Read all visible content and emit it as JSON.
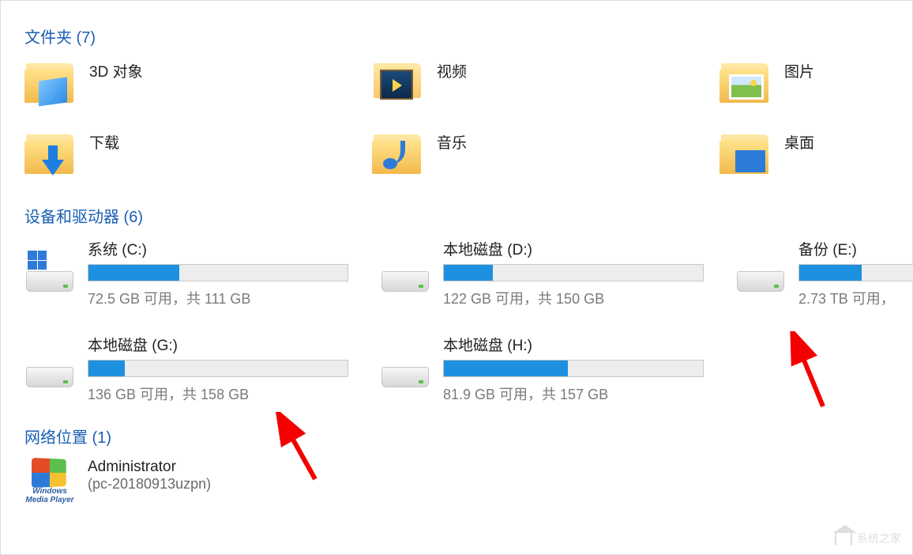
{
  "sections": {
    "folders_header": "文件夹 (7)",
    "drives_header": "设备和驱动器 (6)",
    "network_header": "网络位置 (1)"
  },
  "folders": [
    {
      "label": "3D 对象",
      "icon": "3d"
    },
    {
      "label": "视频",
      "icon": "video"
    },
    {
      "label": "图片",
      "icon": "pic"
    },
    {
      "label": "下载",
      "icon": "down"
    },
    {
      "label": "音乐",
      "icon": "music"
    },
    {
      "label": "桌面",
      "icon": "desk"
    }
  ],
  "drives": [
    {
      "name": "系统 (C:)",
      "sub": "72.5 GB 可用，共 111 GB",
      "fill": 35,
      "system": true,
      "narrow": false
    },
    {
      "name": "本地磁盘 (D:)",
      "sub": "122 GB 可用，共 150 GB",
      "fill": 19,
      "system": false,
      "narrow": false
    },
    {
      "name": "备份 (E:)",
      "sub": "2.73 TB 可用，",
      "fill": 50,
      "system": false,
      "narrow": true
    },
    {
      "name": "本地磁盘 (G:)",
      "sub": "136 GB 可用，共 158 GB",
      "fill": 14,
      "system": false,
      "narrow": false
    },
    {
      "name": "本地磁盘 (H:)",
      "sub": "81.9 GB 可用，共 157 GB",
      "fill": 48,
      "system": false,
      "narrow": false
    }
  ],
  "network": {
    "name": "Administrator",
    "sub": "(pc-20180913uzpn)",
    "icon_caption": "Windows Media Player"
  },
  "watermark": "系统之家"
}
